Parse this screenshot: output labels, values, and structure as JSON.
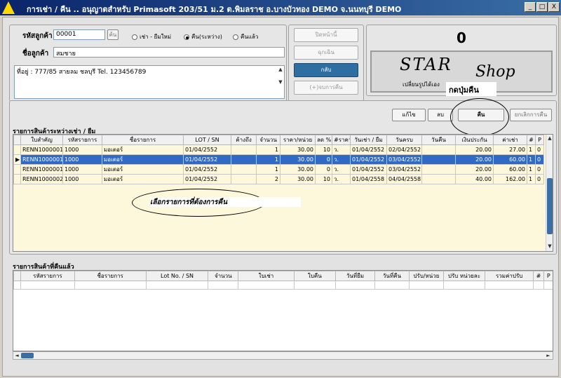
{
  "window": {
    "title": "การเช่า / คืน .. อนุญาตสำหรับ Primasoft 203/51 ม.2 ต.พิมลราช  อ.บางบัวทอง DEMO จ.นนทบุรี DEMO",
    "buttons": [
      "_",
      "□",
      "X"
    ]
  },
  "customer": {
    "code_label": "รหัสลูกค้า",
    "code_value": "00001",
    "code_lookup": "ค้น",
    "name_label": "ชื่อลูกค้า",
    "name_value": "สมชาย",
    "address": "ที่อยู่ : 777/85 สายลม ชลบุรี  Tel. 123456789"
  },
  "mode": {
    "options": [
      "เช่า - ยืมใหม่",
      "คืน(ระหว่าง)",
      "คืนแล้ว"
    ],
    "selected_index": 1
  },
  "actions": {
    "buttons": [
      "ปิดหน้านี้",
      "ฉุกเฉิน",
      "กลับ",
      "(+)จบการคืน"
    ]
  },
  "display": {
    "count": "0",
    "brand_left": "STAR",
    "brand_right": "Shop",
    "subtext": "เปลี่ยนรูปได้เอง",
    "callout": "กดปุ่มคืน"
  },
  "toolbar": {
    "edit": "แก้ไข",
    "delete": "ลบ",
    "return": "คืน",
    "cancel_return": "ยกเลิกการคืน"
  },
  "pending": {
    "title": "รายการสินค้าระหว่างเช่า / ยืม",
    "columns": [
      "ใบสำคัญ",
      "รหัสรายการ",
      "ชื่อรายการ",
      "LOT / SN",
      "ค้างถึง",
      "จำนวน",
      "ราคา/หน่วย",
      "ลด %",
      "#ราคา",
      "วันเช่า / ยืม",
      "วันครบ",
      "วันคืน",
      "เงินประกัน",
      "ค่าเช่า",
      "#",
      "P"
    ],
    "rows": [
      [
        "RENN1000001",
        "1000",
        "มอเตอร์",
        "01/04/2552",
        "",
        "1",
        "30.00",
        "10",
        "ว.",
        "01/04/2552",
        "02/04/2552",
        "",
        "20.00",
        "27.00",
        "1",
        "0"
      ],
      [
        "RENN1000001",
        "1000",
        "มอเตอร์",
        "01/04/2552",
        "",
        "1",
        "30.00",
        "0",
        "ว.",
        "01/04/2552",
        "03/04/2552",
        "",
        "20.00",
        "60.00",
        "1",
        "0"
      ],
      [
        "RENN1000001",
        "1000",
        "มอเตอร์",
        "01/04/2552",
        "",
        "1",
        "30.00",
        "0",
        "ว.",
        "01/04/2552",
        "03/04/2552",
        "",
        "20.00",
        "60.00",
        "1",
        "0"
      ],
      [
        "RENN1000002",
        "1000",
        "มอเตอร์",
        "01/04/2552",
        "",
        "2",
        "30.00",
        "10",
        "ว.",
        "01/04/2558",
        "04/04/2558",
        "",
        "40.00",
        "162.00",
        "1",
        "0"
      ]
    ],
    "selected_row": 1,
    "callout": "เลือกรายการที่ต้องการคืน"
  },
  "returned": {
    "title": "รายการสินค้าที่คืนแล้ว",
    "columns": [
      "รหัสรายการ",
      "ชื่อรายการ",
      "Lot No. / SN",
      "จำนวน",
      "ใบเช่า",
      "ใบคืน",
      "วันที่ยืม",
      "วันที่คืน",
      "ปรับ/หน่วย",
      "ปรับ หน่วยละ",
      "รวมค่าปรับ",
      "#",
      "P"
    ]
  }
}
